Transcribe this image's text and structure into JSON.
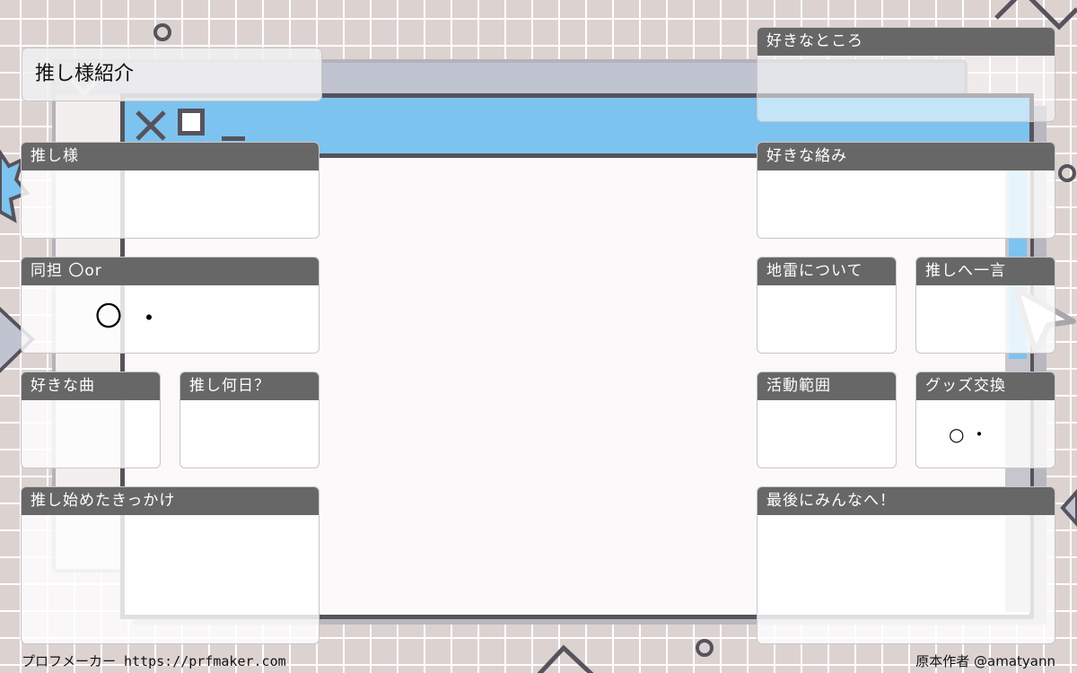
{
  "title": "推し様紹介",
  "panels": {
    "oshi": "推し様",
    "dotan": "同担 〇or",
    "song": "好きな曲",
    "days": "推し何日？",
    "trigger": "推し始めたきっかけ",
    "like_points": "好きなところ",
    "pairing": "好きな絡み",
    "landmine": "地雷について",
    "message": "推しへ一言",
    "activity": "活動範囲",
    "goods": "グッズ交換",
    "last": "最後にみんなへ！"
  },
  "dotan_options": {
    "circle": "〇",
    "dot": "・"
  },
  "goods_options": {
    "circle": "○",
    "dot": "・"
  },
  "footer": {
    "left": "プロフメーカー https://prfmaker.com",
    "right": "原本作者 @amatyann"
  },
  "colors": {
    "accent": "#7dc3ef",
    "header": "#676767",
    "frame": "#56535c"
  }
}
